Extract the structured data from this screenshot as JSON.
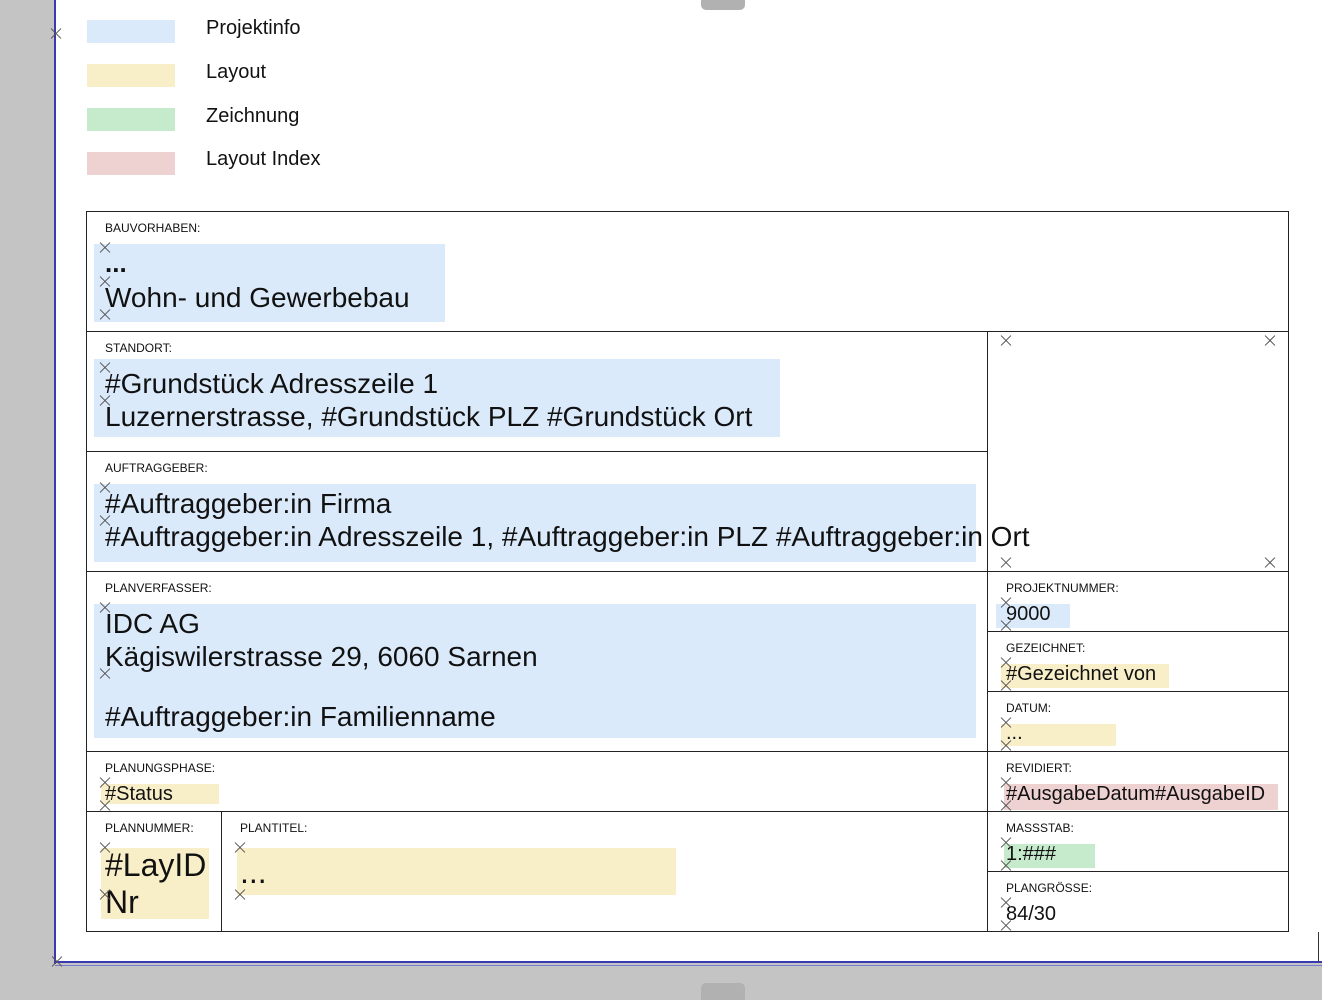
{
  "colors": {
    "projektinfo": "#dbeafb",
    "layout": "#f8efc9",
    "zeichnung": "#c6ebcc",
    "layout_index": "#eed1d1",
    "frame": "#3a3ab0",
    "canvas_bg": "#c4c4c4"
  },
  "legend": {
    "items": [
      {
        "label": "Projektinfo"
      },
      {
        "label": "Layout"
      },
      {
        "label": "Zeichnung"
      },
      {
        "label": "Layout Index"
      }
    ]
  },
  "title_block": {
    "bauvorhaben": {
      "label": "BAUVORHABEN:",
      "line1": "...",
      "line2": "Wohn- und Gewerbebau"
    },
    "standort": {
      "label": "STANDORT:",
      "line1": "#Grundstück Adresszeile 1",
      "line2": "Luzernerstrasse, #Grundstück PLZ #Grundstück Ort"
    },
    "auftraggeber": {
      "label": "AUFTRAGGEBER:",
      "line1": "#Auftraggeber:in Firma",
      "line2": "#Auftraggeber:in Adresszeile 1, #Auftraggeber:in PLZ #Auftraggeber:in Ort"
    },
    "planverfasser": {
      "label": "PLANVERFASSER:",
      "line1": "IDC AG",
      "line2": "Kägiswilerstrasse 29, 6060 Sarnen",
      "line3": "#Auftraggeber:in Familienname"
    },
    "planungsphase": {
      "label": "PLANUNGSPHASE:",
      "value": "#Status"
    },
    "plannummer": {
      "label": "PLANNUMMER:",
      "line1": "#LayID",
      "line2": "Nr"
    },
    "plantitel": {
      "label": "PLANTITEL:",
      "value": "..."
    },
    "projektnummer": {
      "label": "PROJEKTNUMMER:",
      "value": "9000"
    },
    "gezeichnet": {
      "label": "GEZEICHNET:",
      "value": "#Gezeichnet von"
    },
    "datum": {
      "label": "DATUM:",
      "value": "..."
    },
    "revidiert": {
      "label": "REVIDIERT:",
      "value": "#AusgabeDatum#AusgabeID"
    },
    "massstab": {
      "label": "MASSSTAB:",
      "value": "1:###"
    },
    "plangroesse": {
      "label": "PLANGRÖSSE:",
      "value": "84/30"
    }
  }
}
